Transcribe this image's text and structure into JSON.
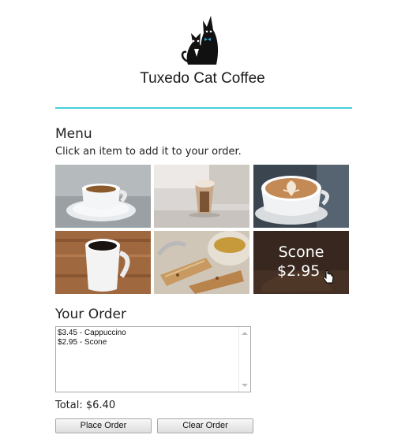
{
  "brand": {
    "name": "Tuxedo Cat Coffee",
    "accent_color": "#45d3d8"
  },
  "menu": {
    "title": "Menu",
    "hint": "Click an item to add it to your order.",
    "items": [
      {
        "icon": "espresso-cup-photo"
      },
      {
        "icon": "hot-chocolate-glass-photo"
      },
      {
        "icon": "latte-art-photo"
      },
      {
        "icon": "black-coffee-mug-photo"
      },
      {
        "icon": "biscotti-tea-photo"
      },
      {
        "icon": "scone-photo",
        "hover_name": "Scone",
        "hover_price": "$2.95"
      }
    ]
  },
  "order": {
    "title": "Your Order",
    "lines": [
      "$3.45 - Cappuccino",
      "$2.95 - Scone"
    ],
    "total_text": "Total: $6.40"
  },
  "buttons": {
    "place": "Place Order",
    "clear": "Clear Order"
  }
}
